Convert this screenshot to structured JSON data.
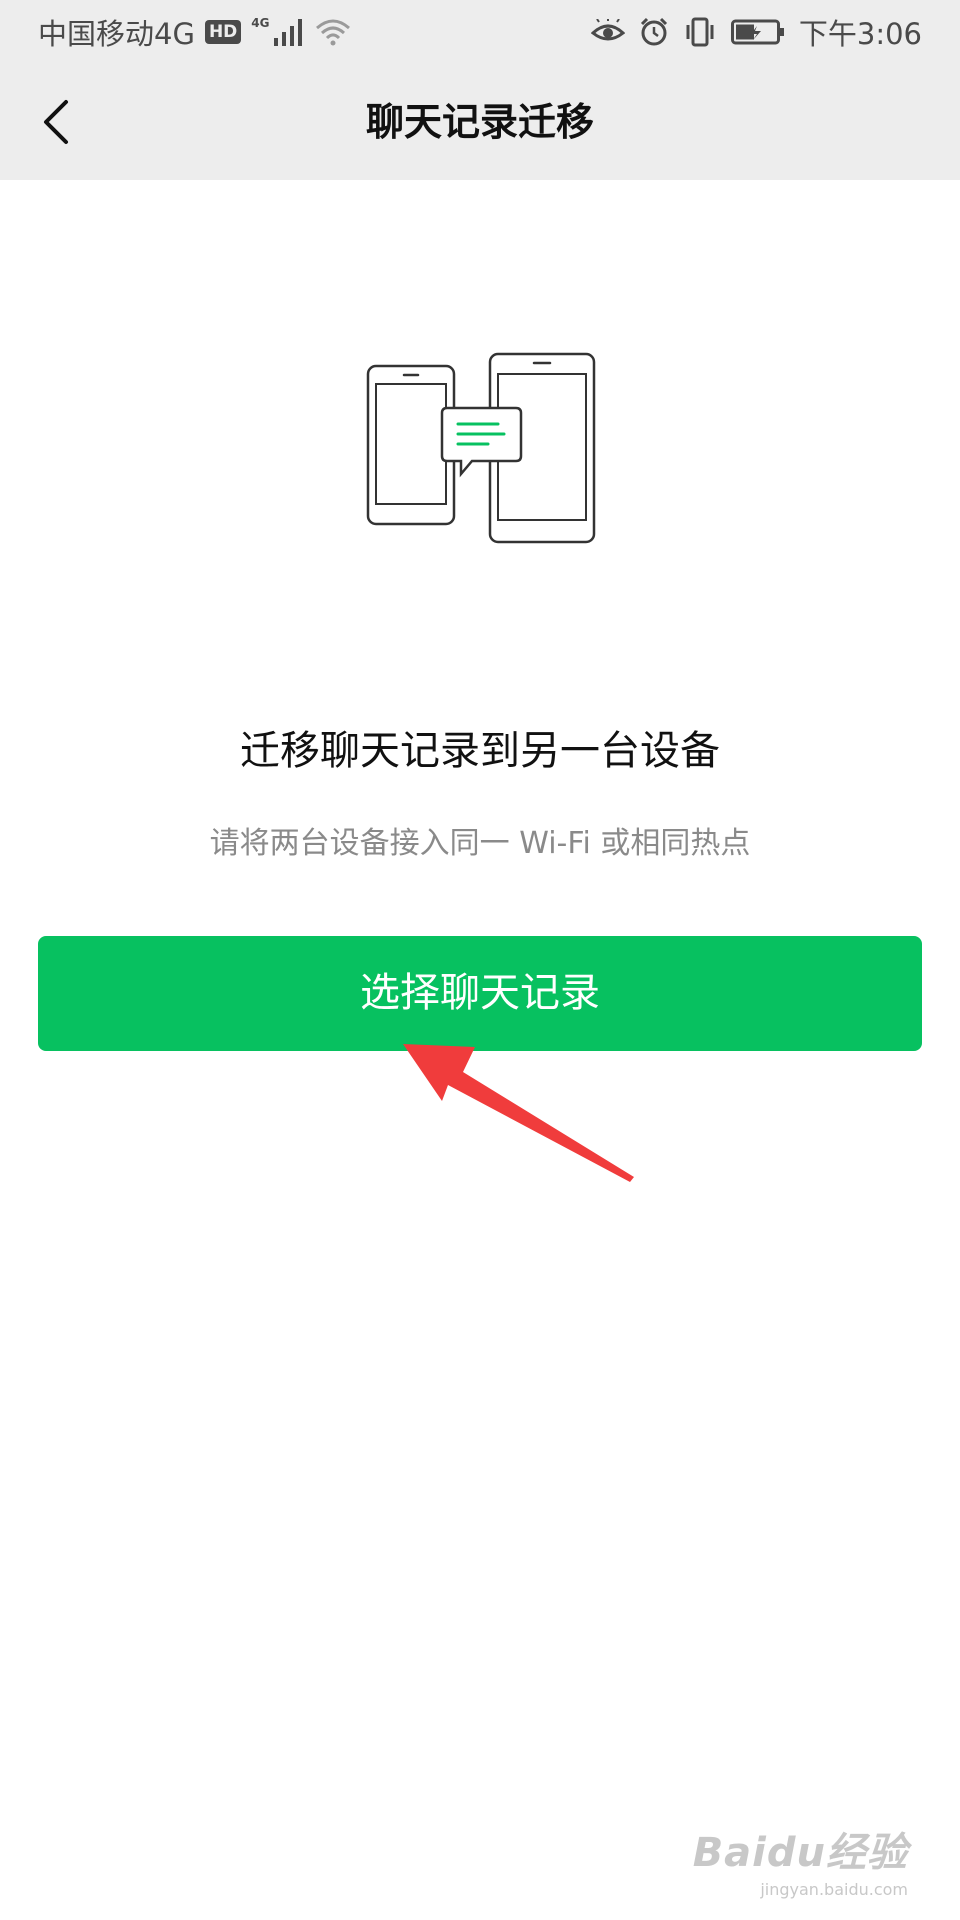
{
  "status_bar": {
    "carrier": "中国移动4G",
    "hd_badge": "HD",
    "network_badge": "4G",
    "time": "下午3:06",
    "icons": [
      "signal-icon",
      "wifi-icon",
      "eye-icon",
      "alarm-icon",
      "vibrate-icon",
      "battery-icon"
    ]
  },
  "nav": {
    "title": "聊天记录迁移",
    "back_icon": "chevron-left-icon"
  },
  "illustration": {
    "icon": "phones-transfer-icon",
    "accent_color": "#07c160"
  },
  "content": {
    "heading": "迁移聊天记录到另一台设备",
    "subtext": "请将两台设备接入同一 Wi-Fi 或相同热点"
  },
  "primary_button": {
    "label": "选择聊天记录",
    "color": "#07c160"
  },
  "annotation": {
    "icon": "red-arrow-icon",
    "color": "#f03c3c"
  },
  "watermark": {
    "brand": "Baidu经验",
    "url": "jingyan.baidu.com"
  }
}
